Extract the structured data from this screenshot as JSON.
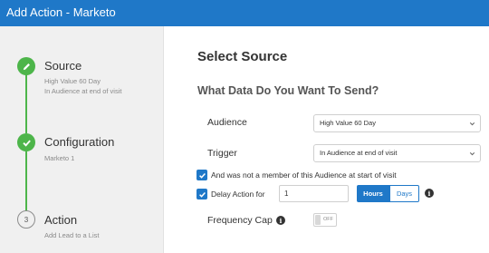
{
  "window": {
    "title": "Add Action - Marketo"
  },
  "sidebar": {
    "steps": [
      {
        "title": "Source",
        "sub1": "High Value 60 Day",
        "sub2": "In Audience at end of visit",
        "status": "done",
        "icon": "pencil-icon"
      },
      {
        "title": "Configuration",
        "sub1": "Marketo 1",
        "status": "done",
        "icon": "check-icon"
      },
      {
        "title": "Action",
        "sub1": "Add Lead to a List",
        "status": "pending",
        "number": "3"
      }
    ]
  },
  "main": {
    "heading": "Select Source",
    "subheading": "What Data Do You Want To Send?",
    "audience": {
      "label": "Audience",
      "value": "High Value 60 Day"
    },
    "trigger": {
      "label": "Trigger",
      "value": "In Audience at end of visit"
    },
    "not_member": {
      "label": "And was not a member of this Audience at start of visit",
      "checked": true
    },
    "delay": {
      "label": "Delay Action for",
      "checked": true,
      "value": "1",
      "units": [
        "Hours",
        "Days"
      ],
      "selected_unit": "Hours"
    },
    "frequency_cap": {
      "label": "Frequency Cap",
      "toggle_text": "OFF"
    }
  },
  "colors": {
    "accent": "#1f78c8",
    "success": "#4db54a",
    "sidebar_bg": "#f0f0f0"
  }
}
